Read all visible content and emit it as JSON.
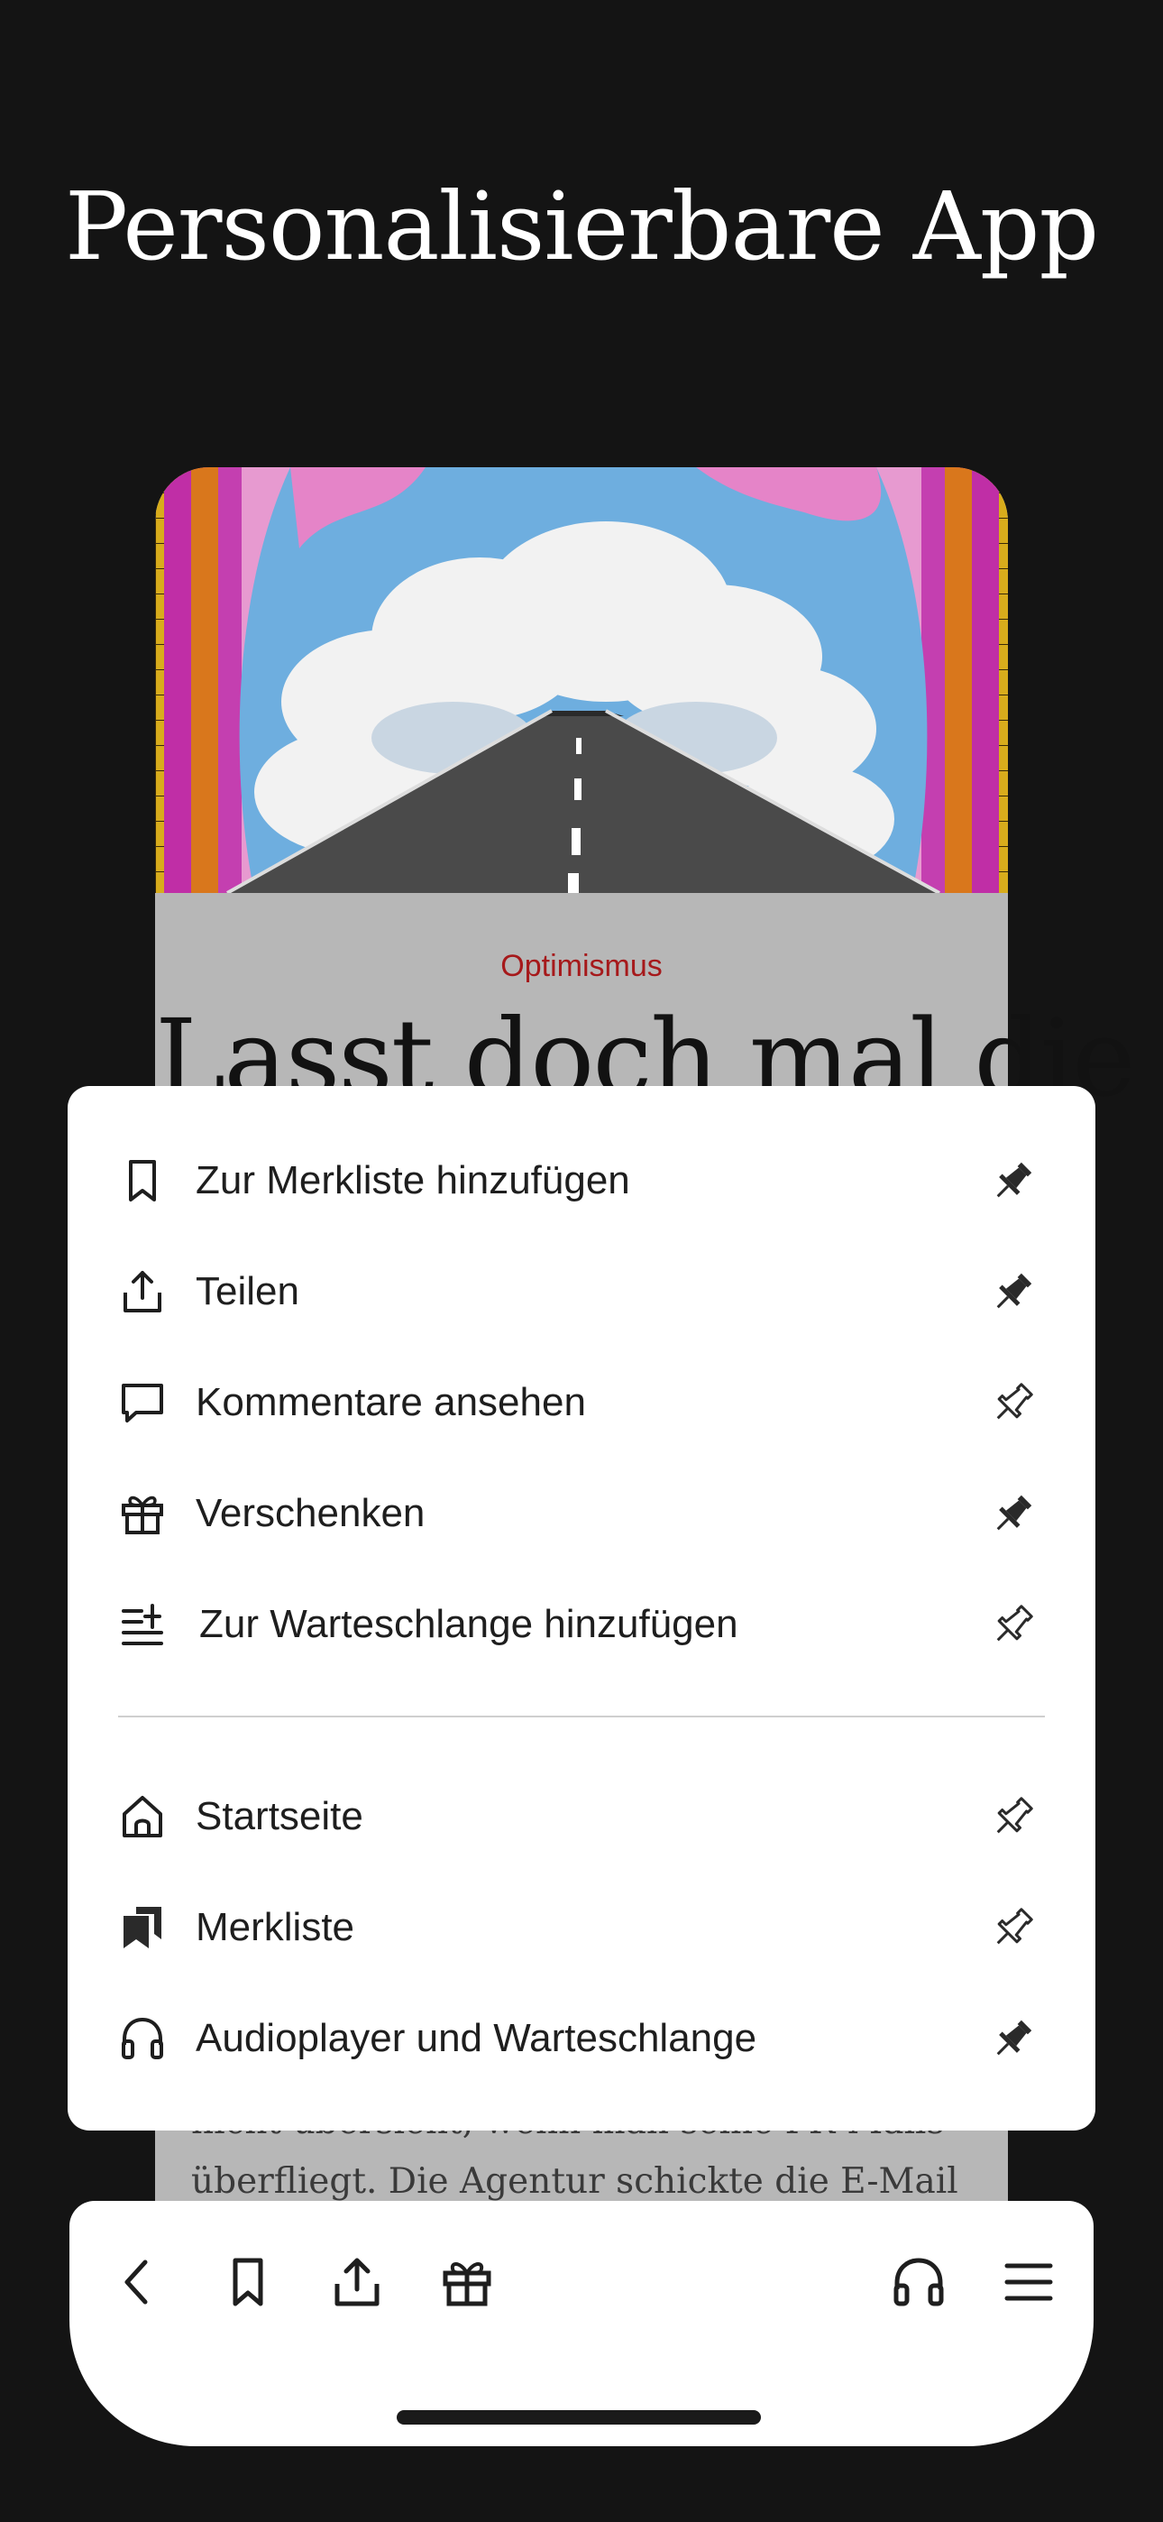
{
  "header": {
    "title": "Personalisierbare App"
  },
  "article": {
    "kicker": "Optimismus",
    "title": "Lasst doch mal die",
    "text_line_1": "nicht übersieht, wenn man seine PR-Mails",
    "text_line_2": "überfliegt. Die Agentur schickte die E-Mail"
  },
  "menu": {
    "actions": [
      {
        "label": "Zur Merkliste hinzufügen",
        "icon": "bookmark-icon",
        "pinned": true
      },
      {
        "label": "Teilen",
        "icon": "share-icon",
        "pinned": true
      },
      {
        "label": "Kommentare ansehen",
        "icon": "comment-icon",
        "pinned": false
      },
      {
        "label": "Verschenken",
        "icon": "gift-icon",
        "pinned": true
      },
      {
        "label": "Zur Warteschlange hinzufügen",
        "icon": "queue-add-icon",
        "pinned": false
      }
    ],
    "navigation": [
      {
        "label": "Startseite",
        "icon": "home-icon",
        "pinned": false
      },
      {
        "label": "Merkliste",
        "icon": "bookmarks-filled-icon",
        "pinned": false
      },
      {
        "label": "Audioplayer und Warteschlange",
        "icon": "headphones-icon",
        "pinned": true
      }
    ]
  },
  "toolbar": {
    "left": [
      "back-icon",
      "bookmark-icon",
      "share-icon",
      "gift-icon"
    ],
    "right": [
      "headphones-icon",
      "menu-icon"
    ]
  },
  "colors": {
    "background": "#141414",
    "kicker": "#a6191b",
    "sheet": "#ffffff",
    "icon": "#1e1e1e"
  }
}
